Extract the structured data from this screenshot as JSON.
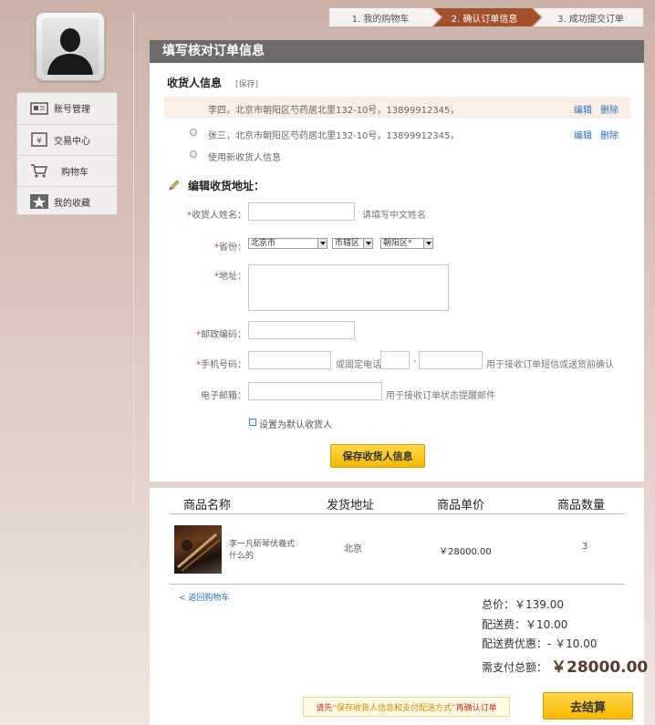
{
  "sidebar": {
    "items": [
      {
        "label": "账号管理",
        "icon": "account-card-icon"
      },
      {
        "label": "交易中心",
        "icon": "yen-box-icon"
      },
      {
        "label": "购物车",
        "icon": "cart-icon"
      },
      {
        "label": "我的收藏",
        "icon": "star-icon"
      }
    ]
  },
  "steps": [
    "1. 我的购物车",
    "2. 确认订单信息",
    "3. 成功提交订单"
  ],
  "panel_title": "填写核对订单信息",
  "receiver": {
    "heading": "收货人信息",
    "save": "[保存]",
    "addresses": [
      {
        "text": "李四，北京市朝阳区芍药居北里132-10号，13899912345，",
        "edit": "编辑",
        "delete": "删除"
      },
      {
        "text": "张三，北京市朝阳区芍药居北里132-10号，13899912345，",
        "edit": "编辑",
        "delete": "删除"
      }
    ],
    "use_new": "使用新收货人信息"
  },
  "edit_form": {
    "heading": "编辑收货地址：",
    "name_label": "收货人姓名：",
    "name_hint": "请填写中文姓名",
    "province_label": "省份：",
    "province": "北京市",
    "city": "市辖区",
    "district": "朝阳区*",
    "address_label": "地址：",
    "zip_label": "邮政编码：",
    "mobile_label": "手机号码：",
    "or_phone": "或固定电话",
    "dash": "-",
    "mobile_hint": "用于接收订单短信或送货前确认",
    "email_label": "电子邮箱：",
    "email_hint": "用于接收订单状态提醒邮件",
    "default_label": "设置为默认收货人",
    "save_button": "保存收货人信息"
  },
  "table": {
    "headers": [
      "商品名称",
      "发货地址",
      "商品单价",
      "商品数量"
    ],
    "rows": [
      {
        "name": "李一凡斫琴伏羲式什么的",
        "address": "北京",
        "price": "￥28000.00",
        "qty": "3"
      }
    ]
  },
  "summary": {
    "back_link": "< 返回购物车",
    "total": "总价：￥139.00",
    "shipping": "配送费：￥10.00",
    "shipping_discount": "配送费优惠：- ￥10.00",
    "due_label": "需支付总额：",
    "due_value": "￥28000.00",
    "notice_a": "请先",
    "notice_b": "“保存收货人信息和支付配送方式”",
    "notice_c": "再确认订单",
    "checkout_button": "去结算"
  }
}
